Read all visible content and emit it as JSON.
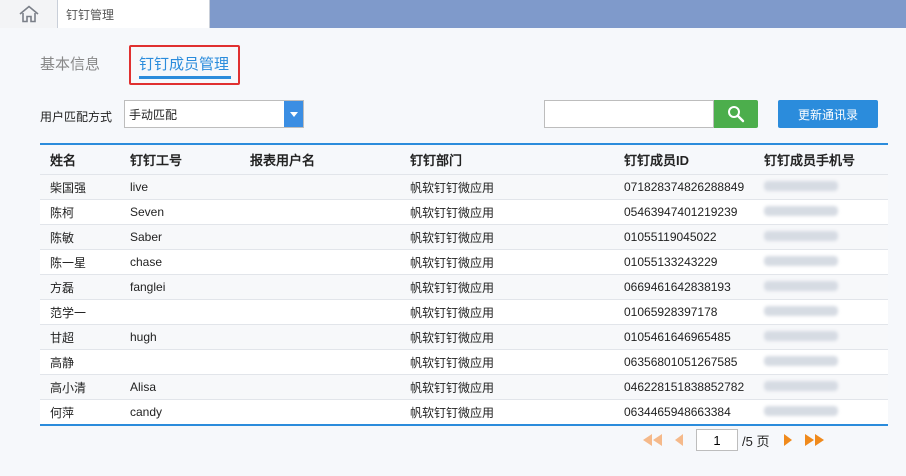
{
  "top_tab": {
    "title": "钉钉管理"
  },
  "subtabs": {
    "basic": "基本信息",
    "dingtalk": "钉钉成员管理"
  },
  "filter": {
    "match_label": "用户匹配方式",
    "match_value": "手动匹配",
    "search_value": "",
    "update_label": "更新通讯录"
  },
  "table": {
    "headers": [
      "姓名",
      "钉钉工号",
      "报表用户名",
      "钉钉部门",
      "钉钉成员ID",
      "钉钉成员手机号"
    ],
    "rows": [
      [
        "柴国强",
        "live",
        "",
        "帆软钉钉微应用",
        "071828374826288849"
      ],
      [
        "陈柯",
        "Seven",
        "",
        "帆软钉钉微应用",
        "05463947401219239"
      ],
      [
        "陈敏",
        "Saber",
        "",
        "帆软钉钉微应用",
        "01055119045022"
      ],
      [
        "陈一星",
        "chase",
        "",
        "帆软钉钉微应用",
        "01055133243229"
      ],
      [
        "方磊",
        "fanglei",
        "",
        "帆软钉钉微应用",
        "0669461642838193"
      ],
      [
        "范学一",
        "",
        "",
        "帆软钉钉微应用",
        "01065928397178"
      ],
      [
        "甘超",
        "hugh",
        "",
        "帆软钉钉微应用",
        "0105461646965485"
      ],
      [
        "高静",
        "",
        "",
        "帆软钉钉微应用",
        "06356801051267585"
      ],
      [
        "高小清",
        "Alisa",
        "",
        "帆软钉钉微应用",
        "046228151838852782"
      ],
      [
        "何萍",
        "candy",
        "",
        "帆软钉钉微应用",
        "0634465948663384"
      ]
    ]
  },
  "pager": {
    "current": "1",
    "total_text": "/5 页"
  },
  "colors": {
    "accent": "#2b8cdc",
    "search_green": "#4cae4c",
    "pager_orange": "#f08a1c",
    "highlight_red": "#e03030"
  }
}
